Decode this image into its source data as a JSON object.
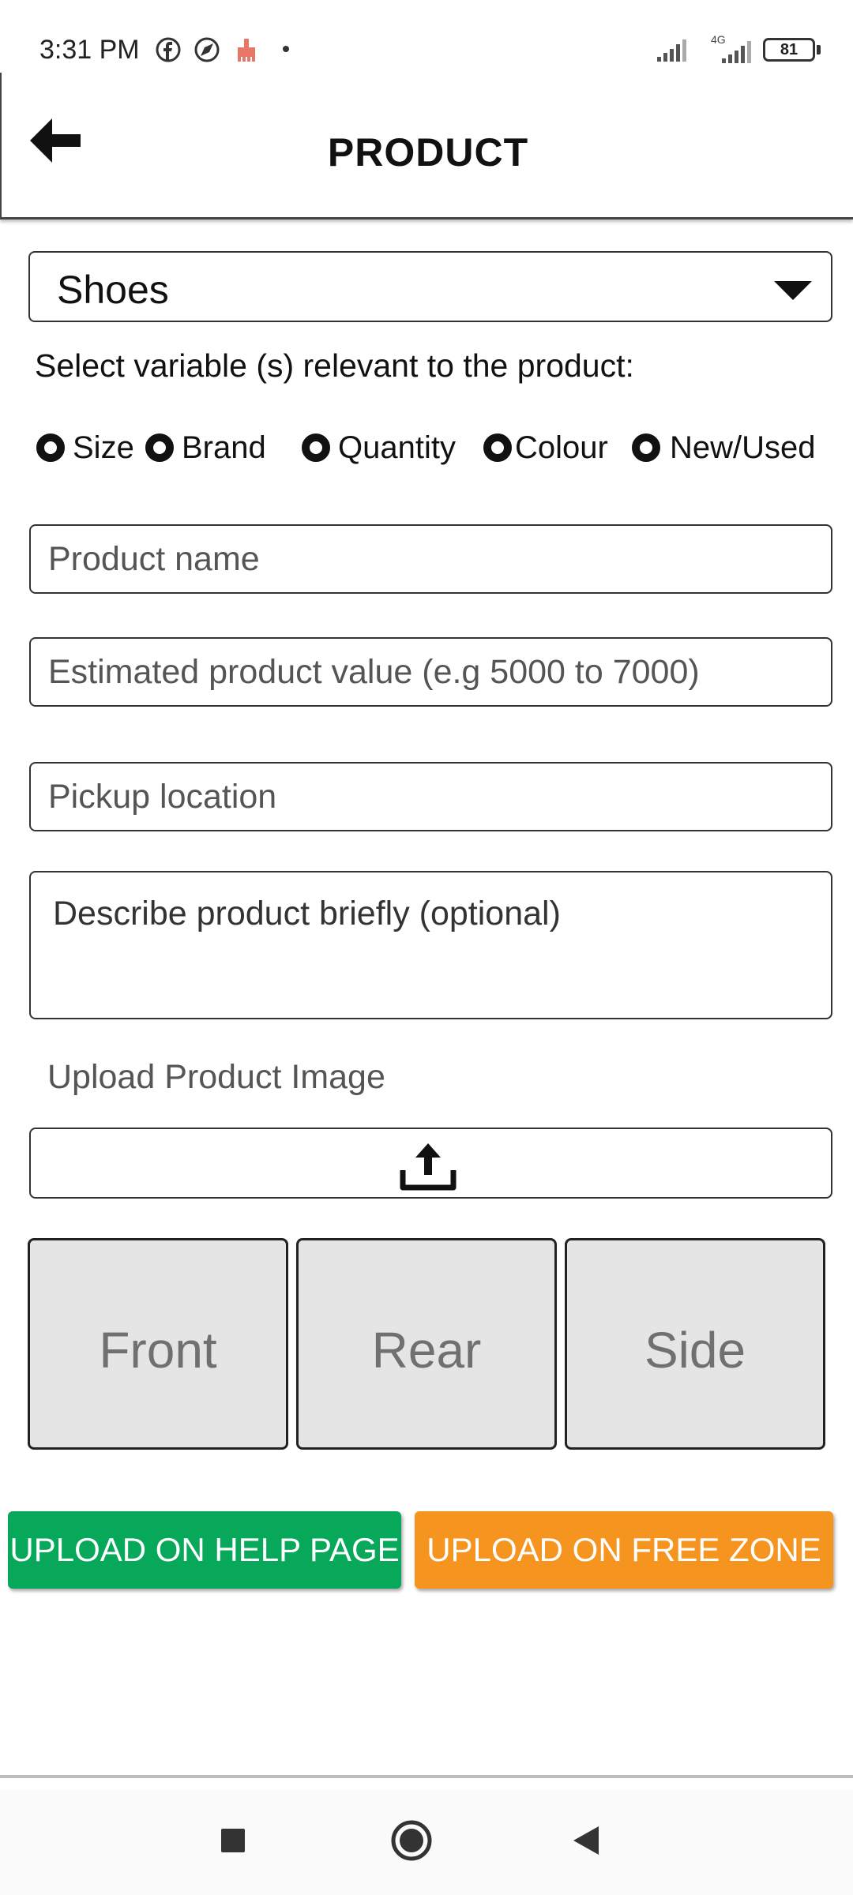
{
  "status_bar": {
    "time": "3:31 PM",
    "battery": "81",
    "network": "4G",
    "icons": [
      "facebook-icon",
      "browser-icon",
      "cleaner-icon",
      "signal-icon",
      "signal-4g-icon",
      "battery-icon"
    ]
  },
  "header": {
    "title": "PRODUCT",
    "back_icon": "arrow-left-icon"
  },
  "form": {
    "category": {
      "value": "Shoes",
      "icon": "caret-down-icon"
    },
    "variables_prompt": "Select variable (s) relevant to the product:",
    "variables": [
      {
        "label": "Size"
      },
      {
        "label": "Brand"
      },
      {
        "label": "Quantity"
      },
      {
        "label": "Colour"
      },
      {
        "label": "New/Used"
      }
    ],
    "product_name": {
      "placeholder": "Product name",
      "value": ""
    },
    "estimated_value": {
      "placeholder": "Estimated product value (e.g 5000 to 7000)",
      "value": ""
    },
    "pickup_location": {
      "placeholder": "Pickup location",
      "value": ""
    },
    "description": {
      "placeholder": "Describe product briefly (optional)",
      "value": ""
    },
    "upload_label": "Upload Product Image",
    "upload_icon": "upload-icon",
    "image_slots": [
      {
        "label": "Front"
      },
      {
        "label": "Rear"
      },
      {
        "label": "Side"
      }
    ]
  },
  "actions": {
    "help_page": {
      "label": "UPLOAD ON HELP PAGE",
      "color": "#07a85a"
    },
    "free_zone": {
      "label": "UPLOAD ON FREE ZONE",
      "color": "#f5951f"
    }
  },
  "nav_bar": {
    "icons": [
      "recents-icon",
      "home-icon",
      "back-triangle-icon"
    ]
  }
}
